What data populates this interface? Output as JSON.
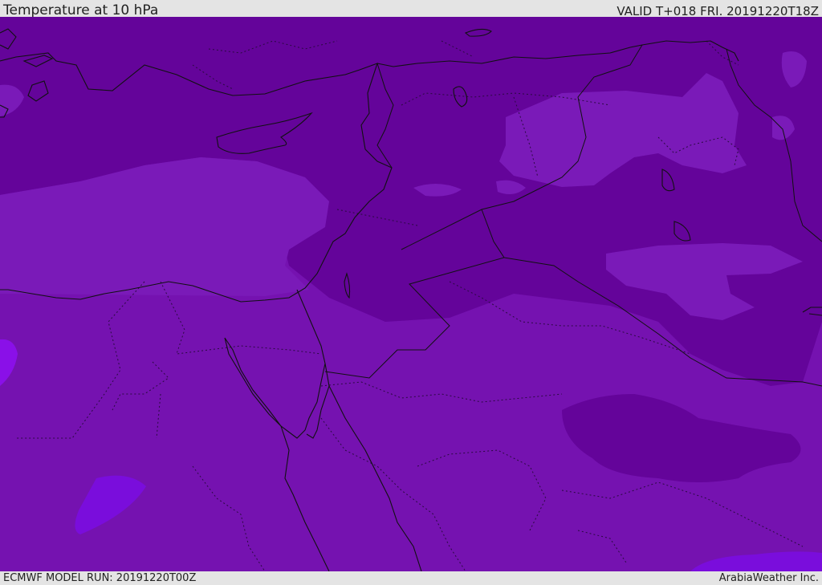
{
  "header": {
    "title": "Temperature at 10 hPa",
    "valid": "VALID T+018 FRI. 20191220T18Z"
  },
  "footer": {
    "model_run": "ECMWF MODEL RUN: 20191220T00Z",
    "credit": "ArabiaWeather Inc."
  },
  "colors": {
    "band_dark": "#64049a",
    "band_mid": "#7512b0",
    "band_light": "#7a1ab8",
    "band_violet": "#7a0ddc",
    "band_bright": "#8a10e8",
    "coastline": "#111111",
    "header_bg": "#e4e4e4"
  }
}
